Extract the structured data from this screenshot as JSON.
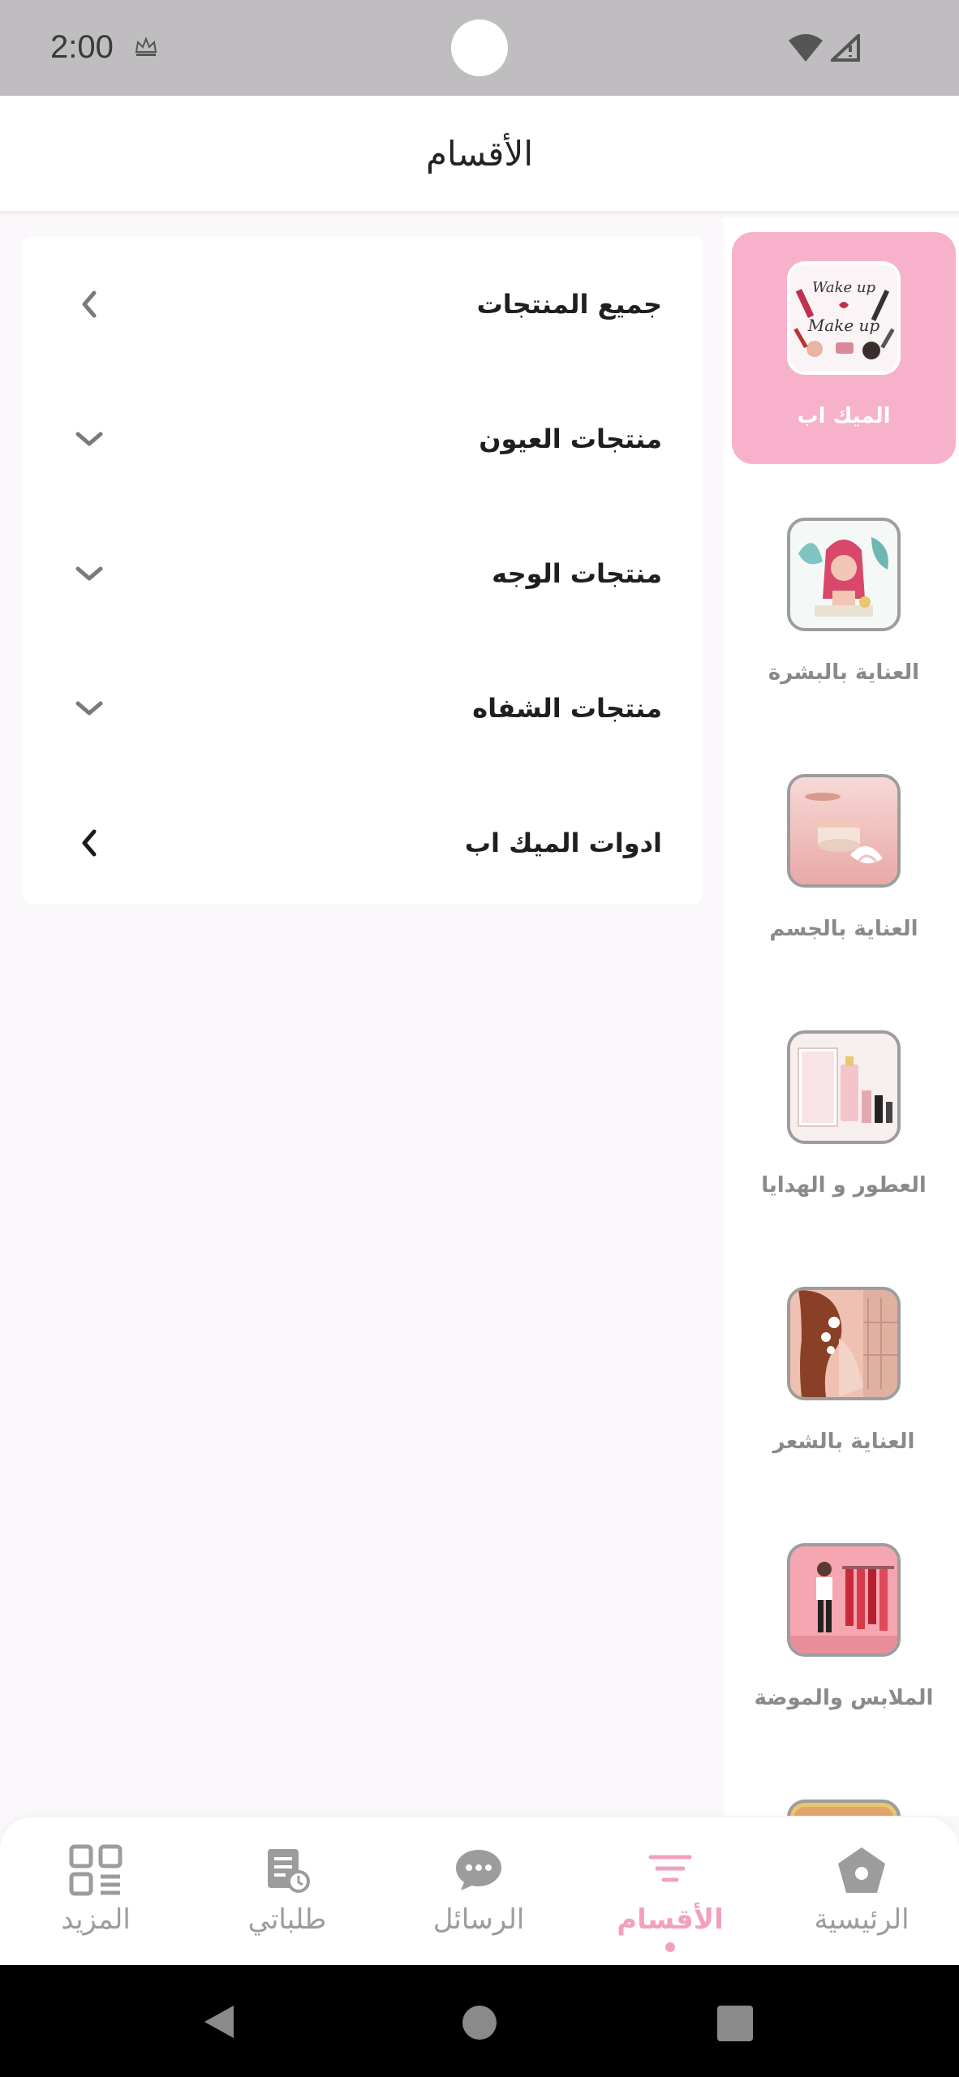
{
  "status_bar": {
    "time": "2:00"
  },
  "header": {
    "title": "الأقسام"
  },
  "categories": [
    {
      "label": "الميك اب",
      "active": true,
      "icon": "makeup-thumbnail"
    },
    {
      "label": "العناية بالبشرة",
      "active": false,
      "icon": "skincare-thumbnail"
    },
    {
      "label": "العناية بالجسم",
      "active": false,
      "icon": "bodycare-thumbnail"
    },
    {
      "label": "العطور و الهدايا",
      "active": false,
      "icon": "perfume-gifts-thumbnail"
    },
    {
      "label": "العناية بالشعر",
      "active": false,
      "icon": "haircare-thumbnail"
    },
    {
      "label": "الملابس والموضة",
      "active": false,
      "icon": "fashion-thumbnail"
    }
  ],
  "subcategories": [
    {
      "label": "جميع المنتجات",
      "icon": "chevron-left-icon"
    },
    {
      "label": "منتجات العيون",
      "icon": "chevron-down-icon"
    },
    {
      "label": "منتجات الوجه",
      "icon": "chevron-down-icon"
    },
    {
      "label": "منتجات الشفاه",
      "icon": "chevron-down-icon"
    },
    {
      "label": "ادوات الميك اب",
      "icon": "chevron-left-icon"
    }
  ],
  "bottom_nav": [
    {
      "label": "المزيد",
      "icon": "grid-icon",
      "active": false
    },
    {
      "label": "طلباتي",
      "icon": "orders-icon",
      "active": false
    },
    {
      "label": "الرسائل",
      "icon": "chat-icon",
      "active": false
    },
    {
      "label": "الأقسام",
      "icon": "filter-icon",
      "active": true
    },
    {
      "label": "الرئيسية",
      "icon": "home-icon",
      "active": false
    }
  ],
  "colors": {
    "accent": "#f3a0c0",
    "active_category_bg": "#f8b1cb",
    "thumb_gold": "#e8c86c"
  }
}
